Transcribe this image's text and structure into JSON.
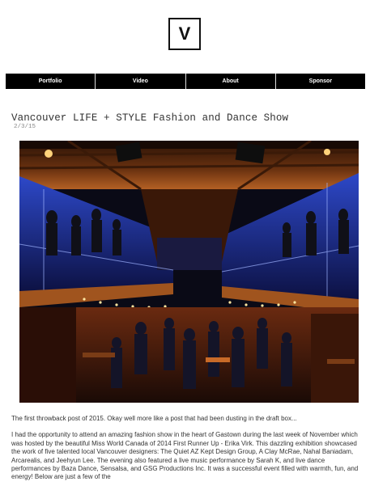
{
  "logo": {
    "letter": "V"
  },
  "nav": {
    "items": [
      {
        "label": "Portfolio"
      },
      {
        "label": "Video"
      },
      {
        "label": "About"
      },
      {
        "label": "Sponsor"
      }
    ]
  },
  "post": {
    "title": "Vancouver LIFE + STYLE Fashion and Dance Show",
    "date": "2/3/15",
    "photo_alt": "Vancouver LIFE + STYLE Fashion and Dance Show",
    "paragraphs": [
      "The first throwback post of 2015. Okay well more like a post that had been dusting in the draft box...",
      "I had the opportunity to attend an amazing fashion show  in the heart of Gastown during the last week of November which was hosted by the beautiful Miss World Canada of 2014 First Runner Up - Erika Virk. This dazzling exhibition showcased the work of five talented local Vancouver designers: The Quiet AZ Kept Design Group, A Clay McRae, Nahal Baniadam, Arcarealis, and Jeehyun Lee. The evening also featured a live music performance by Sarah K, and live dance performances by Baza Dance, Sensalsa, and GSG Productions Inc. It was a successful event filled with warmth, fun, and energy! Below are just a few of the"
    ]
  },
  "colors": {
    "nav_bg": "#000000",
    "nav_text": "#ffffff",
    "title": "#333333",
    "date": "#888888",
    "photo_blue": "#2a3fb8",
    "photo_warm": "#c86a28"
  }
}
